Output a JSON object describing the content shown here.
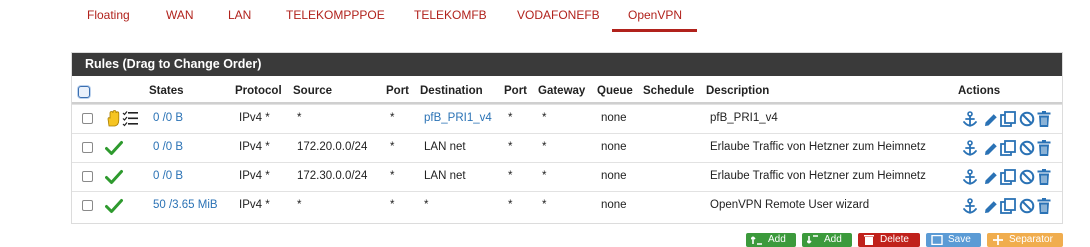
{
  "tabs": [
    {
      "label": "Floating"
    },
    {
      "label": "WAN"
    },
    {
      "label": "LAN"
    },
    {
      "label": "TELEKOMPPPOE"
    },
    {
      "label": "TELEKOMFB"
    },
    {
      "label": "VODAFONEFB"
    },
    {
      "label": "OpenVPN"
    }
  ],
  "active_tab": "OpenVPN",
  "panel": {
    "title": "Rules (Drag to Change Order)"
  },
  "columns": {
    "states": "States",
    "protocol": "Protocol",
    "source": "Source",
    "port": "Port",
    "destination": "Destination",
    "port2": "Port",
    "gateway": "Gateway",
    "queue": "Queue",
    "schedule": "Schedule",
    "description": "Description",
    "actions": "Actions"
  },
  "rows": [
    {
      "status_icon": "hand-icon",
      "states": "0 /0 B",
      "protocol": "IPv4 *",
      "source": "*",
      "port": "*",
      "destination": "pfB_PRI1_v4",
      "port2": "*",
      "gateway": "*",
      "queue": "none",
      "schedule": "",
      "description": "pfB_PRI1_v4"
    },
    {
      "status_icon": "check-icon",
      "states": "0 /0 B",
      "protocol": "IPv4 *",
      "source": "172.20.0.0/24",
      "port": "*",
      "destination": "LAN net",
      "port2": "*",
      "gateway": "*",
      "queue": "none",
      "schedule": "",
      "description": "Erlaube Traffic von Hetzner zum Heimnetz"
    },
    {
      "status_icon": "check-icon",
      "states": "0 /0 B",
      "protocol": "IPv4 *",
      "source": "172.30.0.0/24",
      "port": "*",
      "destination": "LAN net",
      "port2": "*",
      "gateway": "*",
      "queue": "none",
      "schedule": "",
      "description": "Erlaube Traffic von Hetzner zum Heimnetz"
    },
    {
      "status_icon": "check-icon",
      "states": "50 /3.65 MiB",
      "protocol": "IPv4 *",
      "source": "*",
      "port": "*",
      "destination": "*",
      "port2": "*",
      "gateway": "*",
      "queue": "none",
      "schedule": "",
      "description": "OpenVPN Remote User wizard"
    }
  ],
  "bottom_buttons": [
    {
      "label": "Add",
      "icon": "arrow-up-icon",
      "color": "#3c9a3c"
    },
    {
      "label": "Add",
      "icon": "arrow-down-icon",
      "color": "#3c9a3c"
    },
    {
      "label": "Delete",
      "icon": "trash-icon",
      "color": "#c0211b"
    },
    {
      "label": "Save",
      "icon": "save-icon",
      "color": "#5b9bd5"
    },
    {
      "label": "Separator",
      "icon": "plus-icon",
      "color": "#f0ad4e"
    }
  ],
  "colors": {
    "accent": "#b1221c",
    "link": "#2a72b5",
    "check": "#2e9a2e",
    "icon": "#2a72b5",
    "heading_bg": "#3a3a3a"
  }
}
